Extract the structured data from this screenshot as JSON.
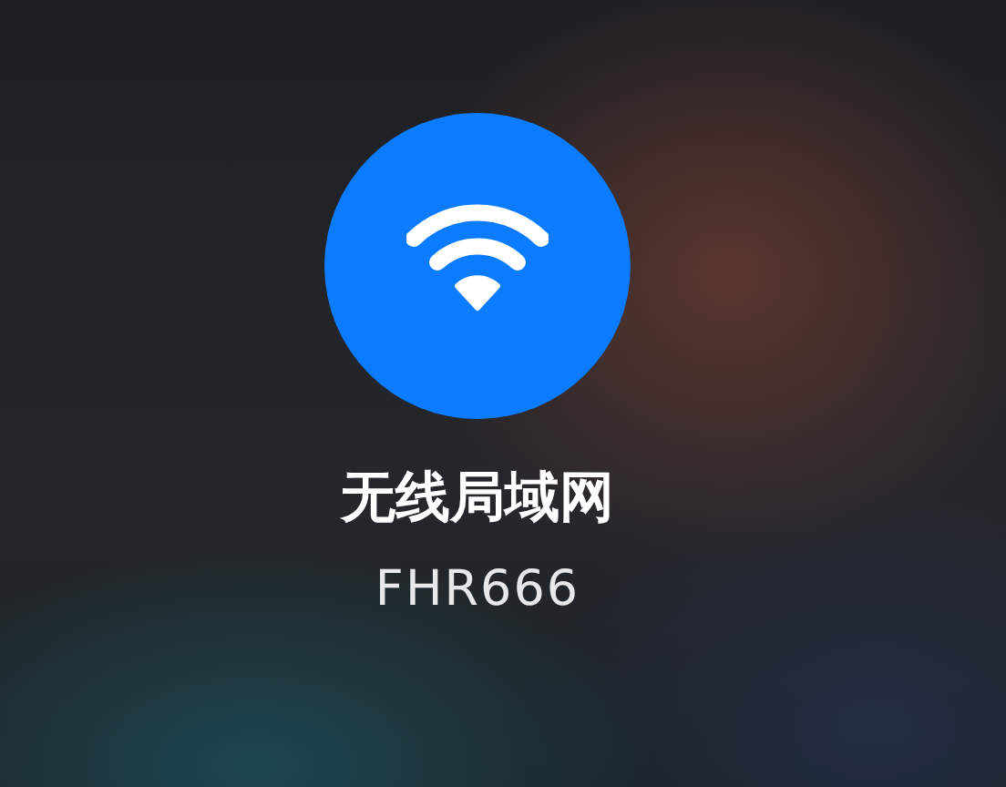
{
  "toggle": {
    "label": "无线局域网",
    "network": "FHR666",
    "on": true
  }
}
